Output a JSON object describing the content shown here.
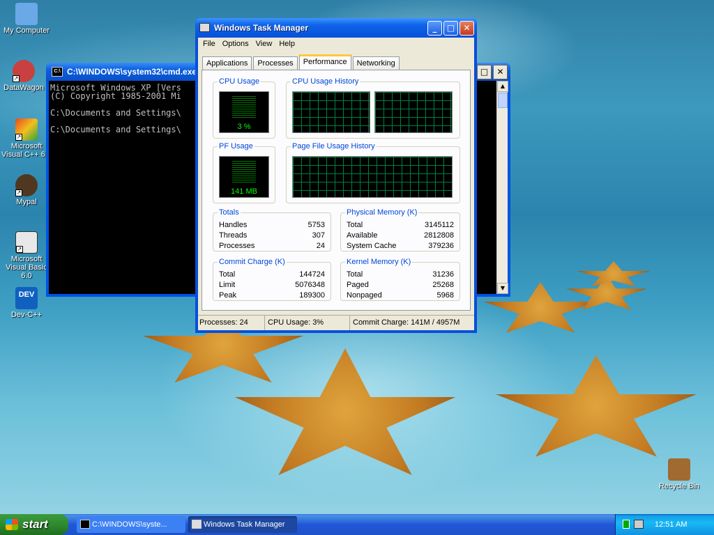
{
  "desktop": {
    "icons": [
      {
        "label": "My Computer",
        "color": "#6aa8e8"
      },
      {
        "label": "DataWagon",
        "color": "#c84040"
      },
      {
        "label": "Microsoft Visual C++ 6.0",
        "color": "#e84820"
      },
      {
        "label": "Mypal",
        "color": "#503820"
      },
      {
        "label": "Microsoft Visual Basic 6.0",
        "color": "#e8e8e8"
      },
      {
        "label": "Dev-C++",
        "color": "#1060c0"
      },
      {
        "label": "Recycle Bin",
        "color": "#a06a30"
      }
    ]
  },
  "cmd": {
    "title": "C:\\WINDOWS\\system32\\cmd.exe",
    "icon_text": "C:\\",
    "lines": "Microsoft Windows XP [Vers\n(C) Copyright 1985-2001 Mi\n\nC:\\Documents and Settings\\\n\nC:\\Documents and Settings\\"
  },
  "taskmgr": {
    "title": "Windows Task Manager",
    "menu": [
      "File",
      "Options",
      "View",
      "Help"
    ],
    "tabs": [
      "Applications",
      "Processes",
      "Performance",
      "Networking"
    ],
    "active_tab": "Performance",
    "cpu_usage_label": "CPU Usage",
    "cpu_usage_value": "3 %",
    "cpu_history_label": "CPU Usage History",
    "pf_usage_label": "PF Usage",
    "pf_usage_value": "141 MB",
    "pf_history_label": "Page File Usage History",
    "totals": {
      "label": "Totals",
      "rows": [
        {
          "k": "Handles",
          "v": "5753"
        },
        {
          "k": "Threads",
          "v": "307"
        },
        {
          "k": "Processes",
          "v": "24"
        }
      ]
    },
    "physical": {
      "label": "Physical Memory (K)",
      "rows": [
        {
          "k": "Total",
          "v": "3145112"
        },
        {
          "k": "Available",
          "v": "2812808"
        },
        {
          "k": "System Cache",
          "v": "379236"
        }
      ]
    },
    "commit": {
      "label": "Commit Charge (K)",
      "rows": [
        {
          "k": "Total",
          "v": "144724"
        },
        {
          "k": "Limit",
          "v": "5076348"
        },
        {
          "k": "Peak",
          "v": "189300"
        }
      ]
    },
    "kernel": {
      "label": "Kernel Memory (K)",
      "rows": [
        {
          "k": "Total",
          "v": "31236"
        },
        {
          "k": "Paged",
          "v": "25268"
        },
        {
          "k": "Nonpaged",
          "v": "5968"
        }
      ]
    },
    "status": {
      "processes": "Processes: 24",
      "cpu": "CPU Usage: 3%",
      "commit": "Commit Charge: 141M / 4957M"
    }
  },
  "taskbar": {
    "start_label": "start",
    "buttons": [
      {
        "label": "C:\\WINDOWS\\syste..."
      },
      {
        "label": "Windows Task Manager"
      }
    ],
    "clock": "12:51 AM"
  }
}
